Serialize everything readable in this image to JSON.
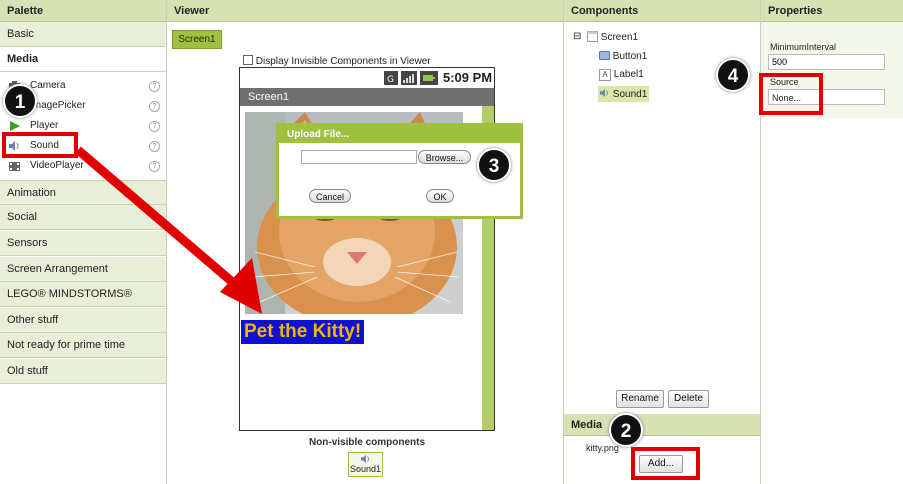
{
  "palette": {
    "header": "Palette",
    "categories_top": [
      {
        "label": "Basic"
      },
      {
        "label": "Media"
      }
    ],
    "media_components": [
      {
        "label": "Camera",
        "icon": "camera-icon"
      },
      {
        "label": "ImagePicker",
        "icon": "image-picker-icon"
      },
      {
        "label": "Player",
        "icon": "player-icon"
      },
      {
        "label": "Sound",
        "icon": "speaker-icon"
      },
      {
        "label": "VideoPlayer",
        "icon": "video-icon"
      }
    ],
    "help_glyph": "?",
    "categories_bottom": [
      {
        "label": "Animation"
      },
      {
        "label": "Social"
      },
      {
        "label": "Sensors"
      },
      {
        "label": "Screen Arrangement"
      },
      {
        "label": "LEGO® MINDSTORMS®"
      },
      {
        "label": "Other stuff"
      },
      {
        "label": "Not ready for prime time"
      },
      {
        "label": "Old stuff"
      }
    ]
  },
  "viewer": {
    "header": "Viewer",
    "screen_tab": "Screen1",
    "display_invisible_label": "Display Invisible Components in Viewer",
    "phone": {
      "time": "5:09 PM",
      "title": "Screen1",
      "button_text": "Pet the Kitty!"
    },
    "non_visible_label": "Non-visible components",
    "non_visible_items": [
      {
        "label": "Sound1",
        "icon": "speaker-icon"
      }
    ]
  },
  "upload_dialog": {
    "title": "Upload File...",
    "file_value": "",
    "browse_label": "Browse...",
    "cancel_label": "Cancel",
    "ok_label": "OK"
  },
  "components": {
    "header": "Components",
    "collapse_glyph": "⊟",
    "tree": [
      {
        "label": "Screen1",
        "icon": "screen-icon"
      },
      {
        "label": "Button1",
        "icon": "button-icon"
      },
      {
        "label": "Label1",
        "icon": "label-icon",
        "glyph": "A"
      },
      {
        "label": "Sound1",
        "icon": "speaker-icon",
        "selected": true
      }
    ],
    "rename_label": "Rename",
    "delete_label": "Delete"
  },
  "media": {
    "header": "Media",
    "files": [
      "kitty.png"
    ],
    "add_label": "Add..."
  },
  "properties": {
    "header": "Properties",
    "minimum_interval_label": "MinimumInterval",
    "minimum_interval_value": "500",
    "source_label": "Source",
    "source_value": "None..."
  },
  "callouts": [
    "1",
    "2",
    "3",
    "4"
  ],
  "colors": {
    "header_bg": "#d6e2b3",
    "accent_green": "#9ec23d",
    "callout_red": "#e00000",
    "kitty_button_bg": "#1010d0",
    "kitty_button_text": "#f2b400"
  }
}
